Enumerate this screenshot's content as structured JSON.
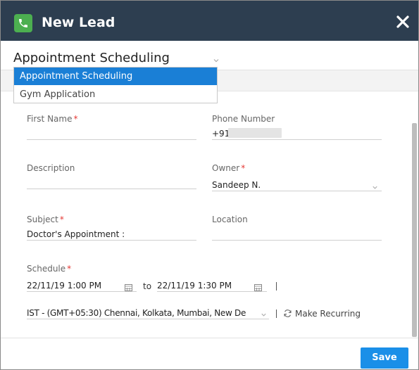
{
  "header": {
    "title": "New Lead"
  },
  "layout_select": {
    "selected": "Appointment Scheduling",
    "options": [
      "Appointment Scheduling",
      "Gym Application"
    ]
  },
  "form": {
    "first_name": {
      "label": "First Name",
      "value": ""
    },
    "phone": {
      "label": "Phone Number",
      "value": "+91-"
    },
    "description": {
      "label": "Description",
      "value": ""
    },
    "owner": {
      "label": "Owner",
      "value": "Sandeep N."
    },
    "subject": {
      "label": "Subject",
      "value": "Doctor's Appointment :"
    },
    "location": {
      "label": "Location",
      "value": ""
    },
    "schedule": {
      "label": "Schedule",
      "start": "22/11/19 1:00 PM",
      "separator": "to",
      "end": "22/11/19 1:30 PM",
      "timezone": "IST - (GMT+05:30) Chennai, Kolkata, Mumbai, New De"
    },
    "required_marker": "*",
    "make_recurring": "Make Recurring"
  },
  "footer": {
    "save_label": "Save"
  },
  "colors": {
    "header_bg": "#2d3e50",
    "accent": "#1a8fe8",
    "dropdown_selected": "#1a7fd6",
    "required": "#e53935",
    "phone_badge": "#4caf50"
  },
  "icons": [
    "phone-icon",
    "close-icon",
    "chevron-down-icon",
    "calendar-icon",
    "refresh-icon"
  ]
}
